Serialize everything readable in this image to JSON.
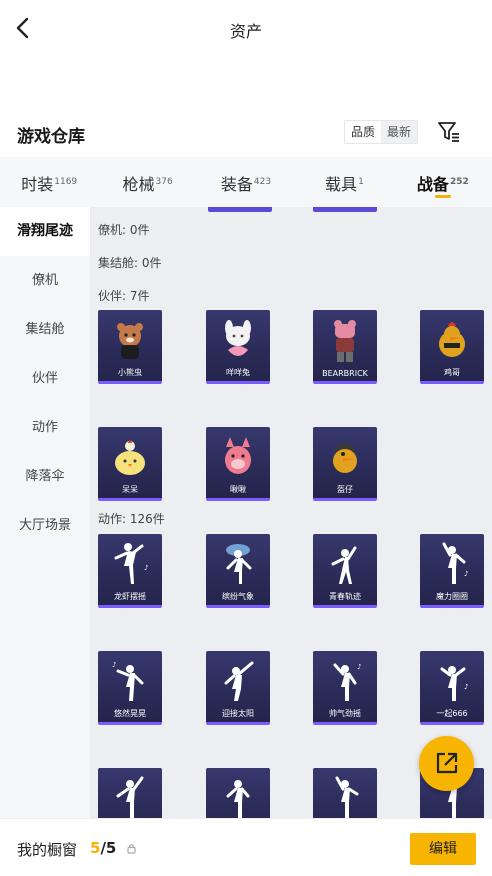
{
  "header": {
    "title": "资产"
  },
  "warehouse": {
    "title": "游戏仓库",
    "sort_quality": "品质",
    "sort_latest": "最新"
  },
  "tabs": [
    {
      "label": "时装",
      "count": "1169"
    },
    {
      "label": "枪械",
      "count": "376"
    },
    {
      "label": "装备",
      "count": "423"
    },
    {
      "label": "载具",
      "count": "1"
    },
    {
      "label": "战备",
      "count": "252"
    }
  ],
  "sidebar": {
    "items": [
      "滑翔尾迹",
      "僚机",
      "集结舱",
      "伙伴",
      "动作",
      "降落伞",
      "大厅场景"
    ]
  },
  "categories": {
    "wingman": "僚机: 0件",
    "pod": "集结舱: 0件",
    "partner": "伙伴: 7件",
    "emote": "动作: 126件"
  },
  "partners": [
    "小熊虫",
    "咩咩兔",
    "BEARBRICK",
    "鸡哥",
    "呆呆",
    "啾啾",
    "盔仔"
  ],
  "emotes": [
    "龙虾摆摇",
    "缤纷气象",
    "青春轨迹",
    "魔力圈圈",
    "悠然晃晃",
    "迎接太阳",
    "帅气劲摇",
    "一起666"
  ],
  "bottom": {
    "label": "我的橱窗",
    "count_current": "5",
    "count_total": "/5",
    "edit": "编辑"
  },
  "colors": {
    "accent": "#f7b400",
    "card": "#2c2c5a",
    "card_border": "#7a5cff"
  }
}
